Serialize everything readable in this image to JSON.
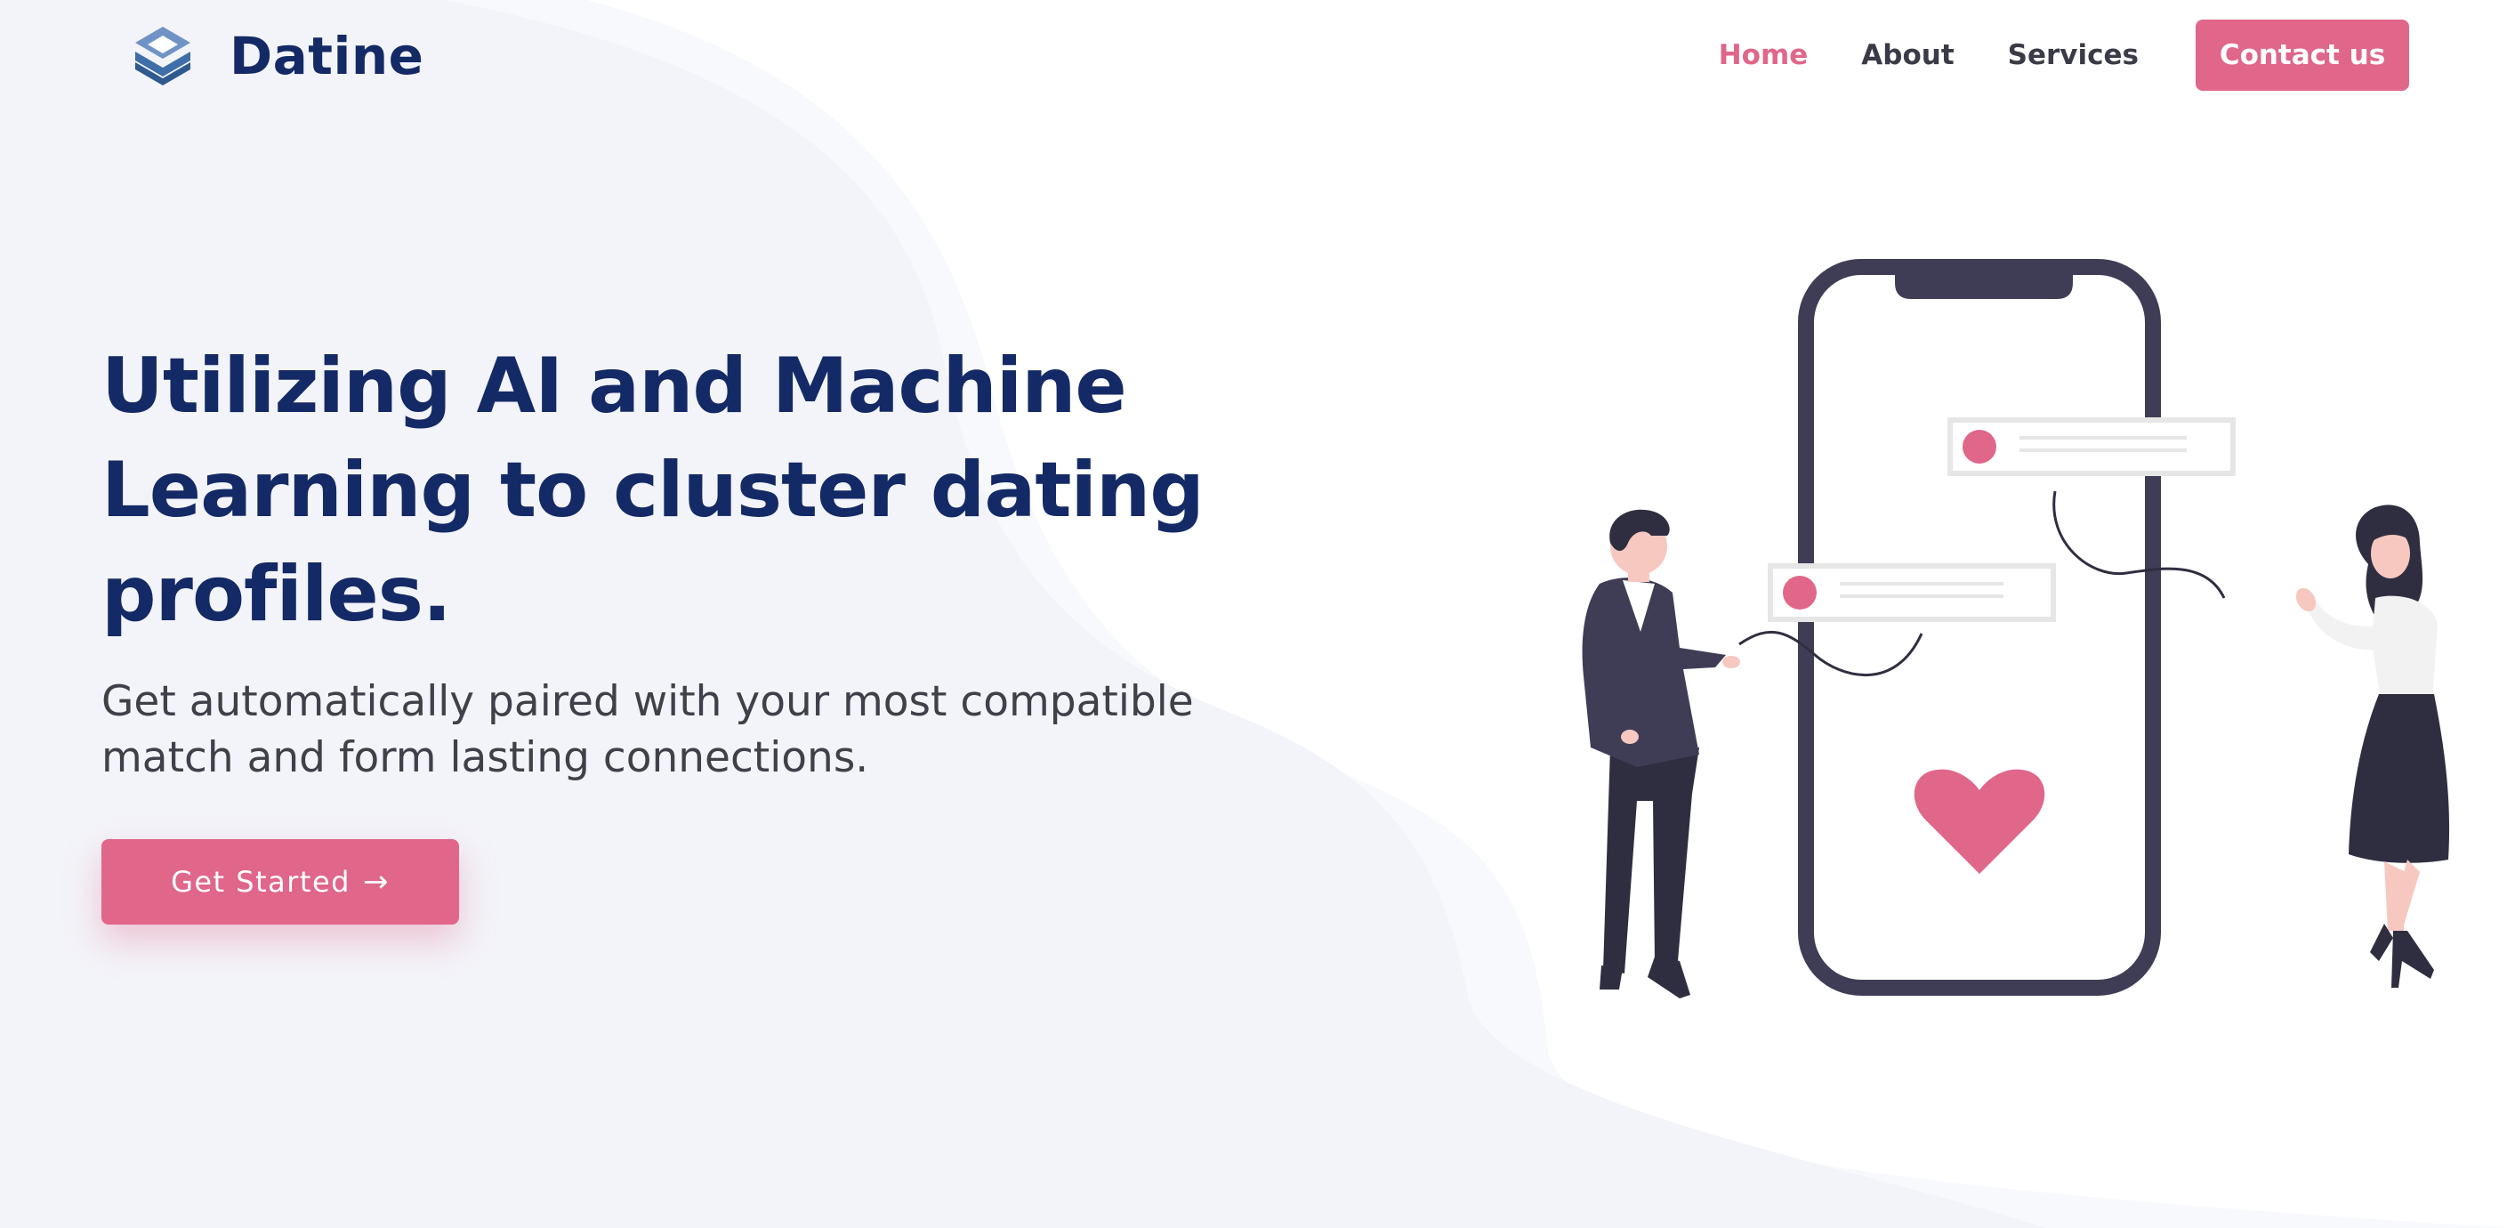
{
  "brand": {
    "name": "Datine",
    "icon": "layered-diamond-logo-icon"
  },
  "nav": {
    "items": [
      {
        "label": "Home",
        "active": true
      },
      {
        "label": "About",
        "active": false
      },
      {
        "label": "Services",
        "active": false
      }
    ],
    "contact_label": "Contact us"
  },
  "hero": {
    "title": "Utilizing AI and Machine Learning to cluster dating profiles.",
    "subtitle": "Get automatically paired with your most compatible match and form lasting connections.",
    "cta_label": "Get Started",
    "cta_icon": "arrow-right-icon"
  },
  "illustration": {
    "subject": "phone-with-chat-bubbles-and-heart",
    "icons": [
      "smartphone",
      "chat-bubble",
      "heart",
      "man-figure",
      "woman-figure"
    ]
  },
  "colors": {
    "accent": "#e0668a",
    "heading": "#142a66",
    "text": "#3f404a",
    "nav_text": "#3a3b46",
    "phone_frame": "#3f3d56",
    "background_wave": "#f3f4f9"
  }
}
